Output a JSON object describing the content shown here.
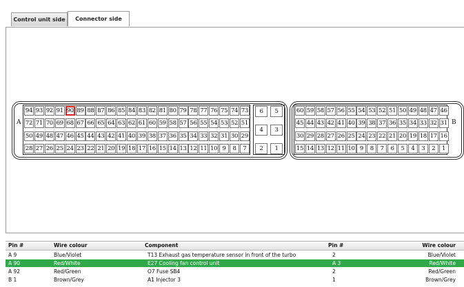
{
  "tabs": [
    {
      "label": "Control unit side",
      "active": false
    },
    {
      "label": "Connector side",
      "active": true
    }
  ],
  "connector": {
    "selected_pin": "90",
    "label_a": "A",
    "label_b": "B",
    "block_a_rows": [
      [
        "94",
        "93",
        "92",
        "91",
        "90",
        "89",
        "88",
        "87",
        "86",
        "85",
        "84",
        "83",
        "82",
        "81",
        "80",
        "79",
        "78",
        "77",
        "76",
        "75",
        "74",
        "73"
      ],
      [
        "72",
        "71",
        "70",
        "69",
        "68",
        "67",
        "66",
        "65",
        "64",
        "63",
        "62",
        "61",
        "60",
        "59",
        "58",
        "57",
        "56",
        "55",
        "54",
        "53",
        "52",
        "51"
      ],
      [
        "50",
        "49",
        "48",
        "47",
        "46",
        "45",
        "44",
        "43",
        "42",
        "41",
        "40",
        "39",
        "38",
        "37",
        "36",
        "35",
        "34",
        "33",
        "32",
        "31",
        "30",
        "29"
      ],
      [
        "28",
        "27",
        "26",
        "25",
        "24",
        "23",
        "22",
        "21",
        "20",
        "19",
        "18",
        "17",
        "16",
        "15",
        "14",
        "13",
        "12",
        "11",
        "10",
        "9",
        "8",
        "7"
      ]
    ],
    "power_pins": [
      [
        "6",
        "5"
      ],
      [
        "4",
        "3"
      ],
      [
        "2",
        "1"
      ]
    ],
    "block_b_rows": [
      [
        "60",
        "59",
        "58",
        "57",
        "56",
        "55",
        "54",
        "53",
        "52",
        "51",
        "50",
        "49",
        "48",
        "47",
        "46"
      ],
      [
        "45",
        "44",
        "43",
        "42",
        "41",
        "40",
        "39",
        "38",
        "37",
        "36",
        "35",
        "34",
        "33",
        "32",
        "31"
      ],
      [
        "30",
        "29",
        "28",
        "27",
        "26",
        "25",
        "24",
        "23",
        "22",
        "21",
        "20",
        "19",
        "18",
        "17",
        "16"
      ],
      [
        "15",
        "14",
        "13",
        "12",
        "11",
        "10",
        "9",
        "8",
        "7",
        "6",
        "5",
        "4",
        "3",
        "2",
        "1"
      ]
    ]
  },
  "table": {
    "headers": [
      "Pin #",
      "Wire colour",
      "Component",
      "Pin #",
      "Wire colour"
    ],
    "rows": [
      {
        "pin": "A 9",
        "wire": "Blue/Violet",
        "component": "T13 Exhaust gas temperature sensor in front of the turbo",
        "pin2": "2",
        "wire2": "Blue/Violet",
        "selected": false
      },
      {
        "pin": "A 90",
        "wire": "Red/White",
        "component": "E27 Cooling fan control unit",
        "pin2": "A 3",
        "wire2": "Red/White",
        "selected": true
      },
      {
        "pin": "A 92",
        "wire": "Red/Green",
        "component": "O7 Fuse SB4",
        "pin2": "2",
        "wire2": "Red/Green",
        "selected": false
      },
      {
        "pin": "B 1",
        "wire": "Brown/Grey",
        "component": "A1 Injector 3",
        "pin2": "1",
        "wire2": "Brown/Grey",
        "selected": false
      }
    ]
  }
}
